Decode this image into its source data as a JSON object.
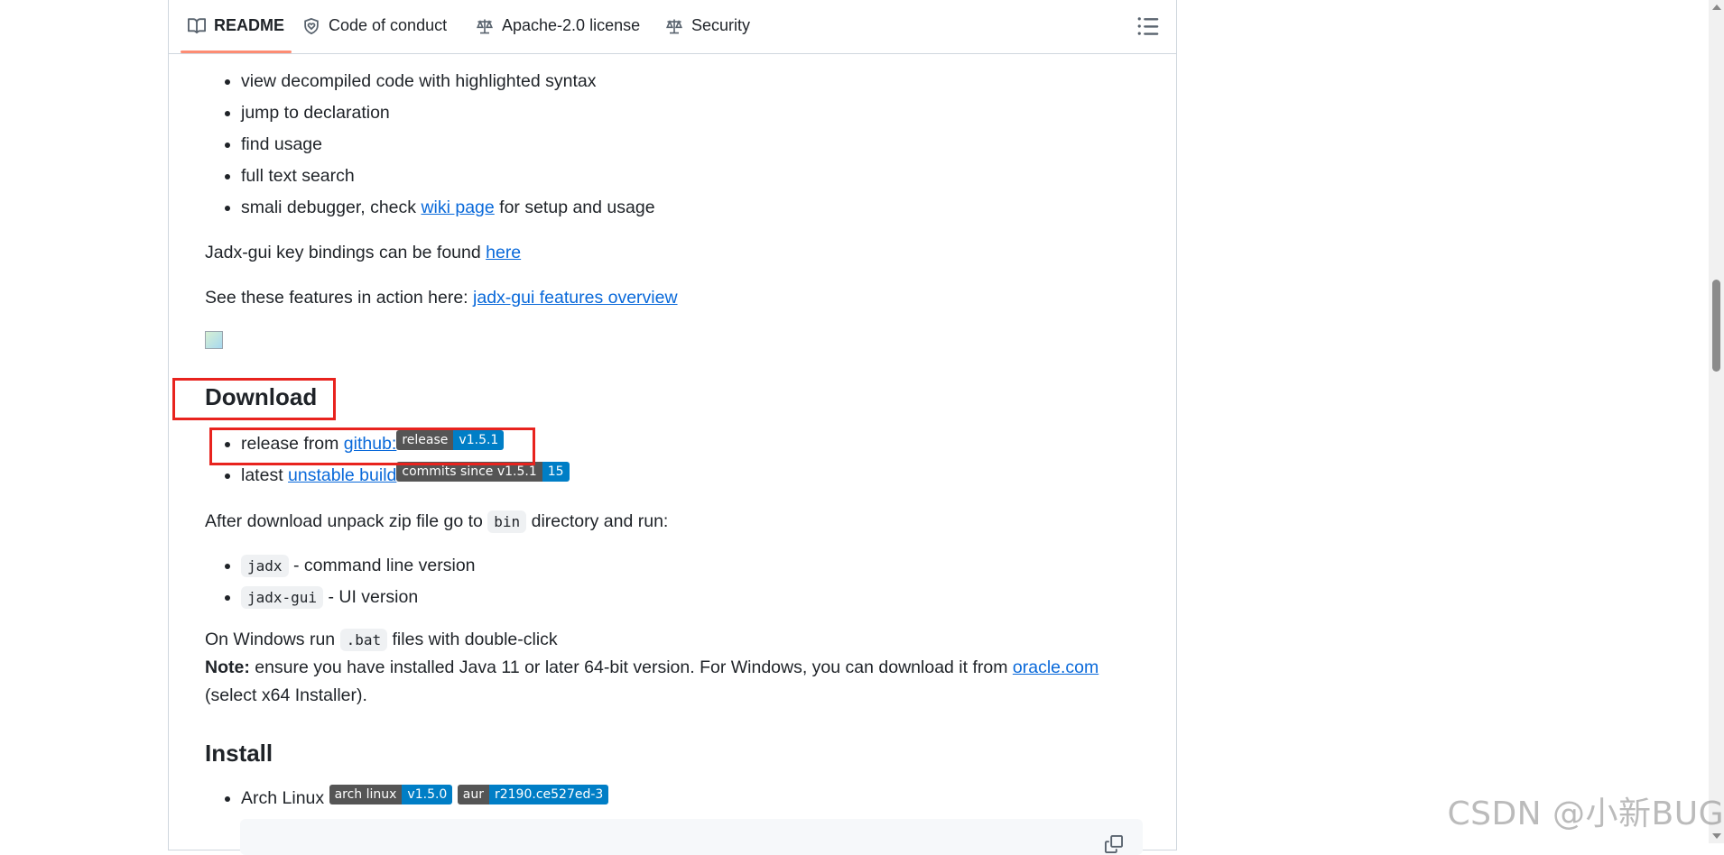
{
  "tabs": [
    {
      "label": "README",
      "icon": "book-icon"
    },
    {
      "label": "Code of conduct",
      "icon": "heart-shield-icon"
    },
    {
      "label": "Apache-2.0 license",
      "icon": "scale-icon"
    },
    {
      "label": "Security",
      "icon": "scale-icon"
    }
  ],
  "features": {
    "items": [
      "view decompiled code with highlighted syntax",
      "jump to declaration",
      "find usage",
      "full text search"
    ],
    "debugger_prefix": "smali debugger, check ",
    "debugger_link": "wiki page",
    "debugger_suffix": " for setup and usage"
  },
  "keybindings": {
    "text": "Jadx-gui key bindings can be found ",
    "link": "here"
  },
  "features_action": {
    "text": "See these features in action here: ",
    "link": "jadx-gui features overview"
  },
  "download": {
    "heading": "Download",
    "release_prefix": "release from ",
    "release_link": "github:",
    "release_badge": {
      "left": "release",
      "right": "v1.5.1"
    },
    "latest_prefix": "latest ",
    "latest_link": "unstable build",
    "latest_badge": {
      "left": "commits since v1.5.1",
      "right": "15"
    },
    "after_prefix": "After download unpack zip file go to ",
    "after_code": "bin",
    "after_suffix": " directory and run:",
    "runs": [
      {
        "code": "jadx",
        "text": " - command line version"
      },
      {
        "code": "jadx-gui",
        "text": " - UI version"
      }
    ],
    "windows_prefix": "On Windows run ",
    "windows_code": ".bat",
    "windows_suffix": " files with double-click",
    "note_label": "Note:",
    "note_text": " ensure you have installed Java 11 or later 64-bit version. For Windows, you can download it from ",
    "note_link": "oracle.com",
    "note_end": "(select x64 Installer)."
  },
  "install": {
    "heading": "Install",
    "arch_label": "Arch Linux",
    "arch_badge": {
      "left": "arch linux",
      "right": "v1.5.0"
    },
    "aur_badge": {
      "left": "aur",
      "right": "r2190.ce527ed-3"
    }
  },
  "watermark": "CSDN @小新BUG",
  "colors": {
    "link": "#0969da",
    "badge_left": "#555555",
    "badge_right": "#007ec6",
    "highlight": "#e8231e",
    "tab_underline": "#fd8c73"
  }
}
